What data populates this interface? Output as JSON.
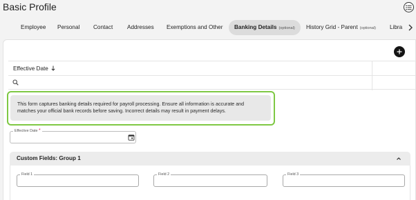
{
  "header": {
    "title": "Basic Profile",
    "menu_icon": "list-icon"
  },
  "tabs": [
    {
      "label": "Employee",
      "optional": ""
    },
    {
      "label": "Personal",
      "optional": ""
    },
    {
      "label": "Contact",
      "optional": ""
    },
    {
      "label": "Addresses",
      "optional": ""
    },
    {
      "label": "Exemptions and Other",
      "optional": ""
    },
    {
      "label": "Banking Details",
      "optional": "(optional)",
      "active": true
    },
    {
      "label": "History Grid - Parent",
      "optional": "(optional)"
    },
    {
      "label": "Libra",
      "optional": ""
    }
  ],
  "grid": {
    "column_header": "Effective Date",
    "sort_icon": "arrow-down-icon",
    "search_icon": "search-icon",
    "add_icon": "plus-icon"
  },
  "notice": {
    "line1": "This form captures banking details required for payroll processing. Ensure all information is accurate and",
    "line2": "matches your official bank records before saving. Incorrect details may result in payment delays.",
    "highlight_color": "#7ec843"
  },
  "effective_date_field": {
    "label": "Effective Date",
    "required_mark": "*",
    "value": "",
    "icon": "calendar-icon"
  },
  "custom_group": {
    "title": "Custom Fields: Group 1",
    "toggle_icon": "chevron-up-icon",
    "fields": [
      {
        "label": "Field 1",
        "value": ""
      },
      {
        "label": "Field 2",
        "value": ""
      },
      {
        "label": "Field 3",
        "value": ""
      }
    ]
  }
}
